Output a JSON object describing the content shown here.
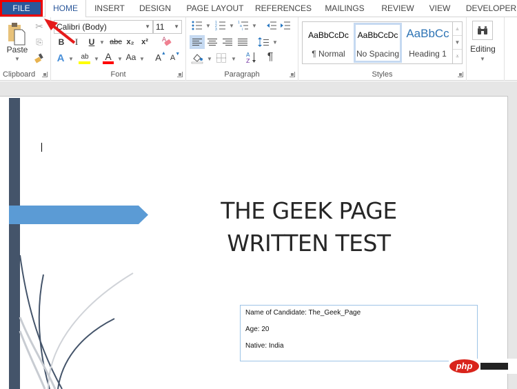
{
  "tabs": [
    {
      "label": "FILE"
    },
    {
      "label": "HOME"
    },
    {
      "label": "INSERT"
    },
    {
      "label": "DESIGN"
    },
    {
      "label": "PAGE LAYOUT"
    },
    {
      "label": "REFERENCES"
    },
    {
      "label": "MAILINGS"
    },
    {
      "label": "REVIEW"
    },
    {
      "label": "VIEW"
    },
    {
      "label": "DEVELOPER"
    }
  ],
  "active_tab": "HOME",
  "ribbon": {
    "clipboard": {
      "label": "Clipboard",
      "paste_label": "Paste",
      "icons": [
        "paste-icon",
        "cut-icon",
        "copy-icon",
        "format-painter-icon"
      ]
    },
    "font": {
      "label": "Font",
      "font_name": "Calibri (Body)",
      "font_size": "11",
      "bold": "B",
      "italic": "I",
      "underline": "U",
      "strikethrough": "abc",
      "subscript": "x₂",
      "superscript": "x²",
      "text_effects": "A",
      "highlight": "ab",
      "font_color": "A",
      "change_case": "Aa",
      "grow_font": "A",
      "shrink_font": "A",
      "highlight_color": "#ffff00",
      "font_color_value": "#ff0000"
    },
    "paragraph": {
      "label": "Paragraph",
      "pilcrow": "¶",
      "sort": "A↓Z",
      "active_alignment": "left"
    },
    "styles": {
      "label": "Styles",
      "items": [
        {
          "preview": "AaBbCcDc",
          "name": "¶ Normal"
        },
        {
          "preview": "AaBbCcDc",
          "name": "No Spacing",
          "selected": true
        },
        {
          "preview": "AaBbCc",
          "name": "Heading 1"
        }
      ]
    },
    "editing": {
      "label": "Editing"
    }
  },
  "document": {
    "title_line1": "THE GEEK PAGE",
    "title_line2": "WRITTEN TEST",
    "info": [
      "Name of Candidate: The_Geek_Page",
      "Age: 20",
      "Native: India"
    ]
  },
  "watermark": "php",
  "colors": {
    "file_tab": "#2b579a",
    "annotation": "#e00000",
    "strip": "#44546a",
    "banner": "#5b9bd5"
  }
}
